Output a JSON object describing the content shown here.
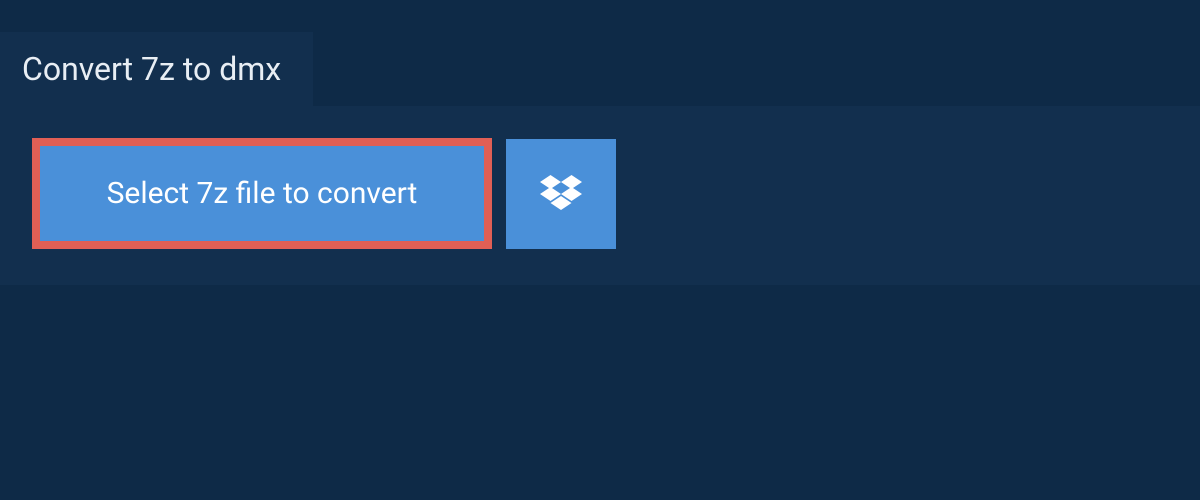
{
  "header": {
    "tab_label": "Convert 7z to dmx"
  },
  "panel": {
    "select_button_label": "Select 7z file to convert"
  },
  "colors": {
    "background": "#0e2a47",
    "panel": "#122f4e",
    "button": "#4a90d9",
    "highlight_border": "#e15f55",
    "text_light": "#ffffff"
  }
}
